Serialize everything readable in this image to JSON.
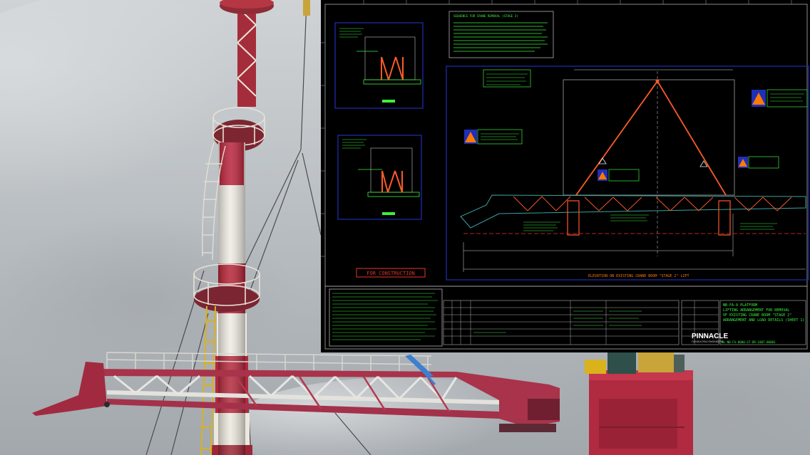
{
  "photo": {
    "description_colors": {
      "sky_top": "#c9cdd0",
      "sky_bottom": "#a9aeb3",
      "mast_red": "#b8233a",
      "mast_white": "#eeeae2",
      "boom_red": "#a8334a",
      "boom_white": "#e6e6e2",
      "safety_yellow": "#d9b21c",
      "strap_blue": "#3d7fd1"
    }
  },
  "drawing": {
    "note_heading": "SEQUENCE FOR CRANE REMOVAL (STAGE 2)",
    "stamp": "FOR CONSTRUCTION",
    "elevation_caption": "ELEVATION ON EXISTING CRANE BOOM \"STAGE 2\" LIFT",
    "company": "PINNACLE",
    "company_sub": "CONSULTING ENGINEERS",
    "title_lines": [
      "NB-FA-0 PLATFORM",
      "LIFTING ARRANGEMENT FOR REMOVAL",
      "OF EXISTING CRANE BOOM \"STAGE 2\"",
      "ARRANGEMENT AND LOAD DETAILS (SHEET 1)"
    ],
    "drawing_number": "NL-NB-FA-0000-ST-DR-1007-00001",
    "colors": {
      "background": "#000000",
      "frame": "#1f2fb8",
      "text": "#3df03d",
      "sling": "#ff5a28",
      "warning": "#ff7a00",
      "stamp": "#e8332a",
      "dim": "#e8e8e8"
    }
  }
}
